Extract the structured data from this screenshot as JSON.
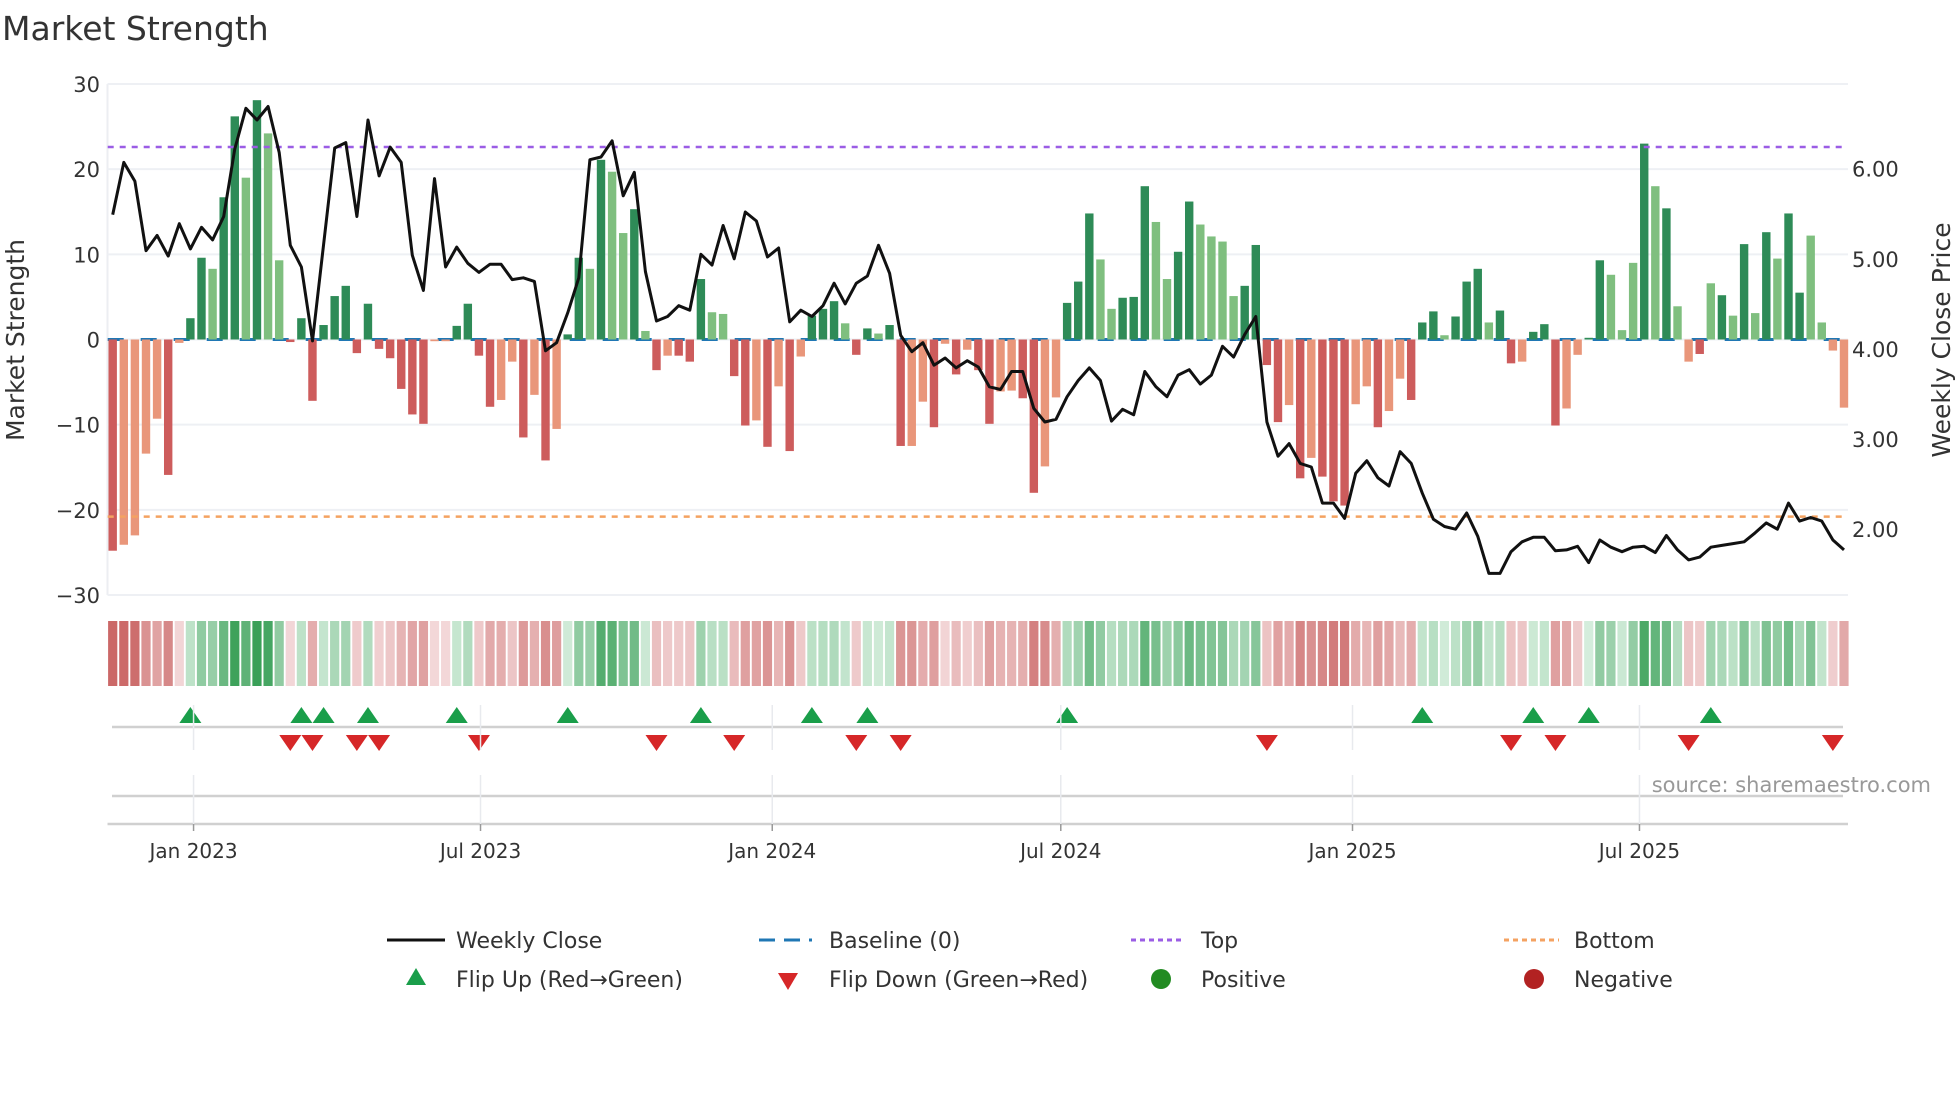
{
  "title": "Market Strength",
  "source": "source: sharemaestro.com",
  "colors": {
    "bar_pos_dark": "#2e8b57",
    "bar_pos_light": "#7fbf7f",
    "bar_neg_dark": "#cd5c5c",
    "bar_neg_light": "#e9967a",
    "baseline": "#1f77b4",
    "top": "#9b5de5",
    "bottom": "#f4a261",
    "flip_up": "#1a9e4a",
    "flip_down": "#d62728",
    "positive": "#228b22",
    "negative": "#b22222",
    "price": "#111111"
  },
  "chart_data": {
    "type": "bar+line",
    "title": "Market Strength",
    "ylabel": "Market Strength",
    "y2label": "Weekly Close Price",
    "ylim": [
      -30,
      30
    ],
    "y2lim": [
      1.27,
      6.94
    ],
    "yticks": [
      "30",
      "20",
      "10",
      "0",
      "−10",
      "−20",
      "−30"
    ],
    "ytick_values": [
      30,
      20,
      10,
      0,
      -10,
      -20,
      -30
    ],
    "y2ticks": [
      "6.00",
      "5.00",
      "4.00",
      "3.00",
      "2.00"
    ],
    "y2tick_values": [
      6,
      5,
      4,
      3,
      2
    ],
    "xticks": [
      {
        "label": "Jan 2023",
        "date": "2023-01-01"
      },
      {
        "label": "Jul 2023",
        "date": "2023-07-01"
      },
      {
        "label": "Jan 2024",
        "date": "2024-01-01"
      },
      {
        "label": "Jul 2024",
        "date": "2024-07-01"
      },
      {
        "label": "Jan 2025",
        "date": "2025-01-01"
      },
      {
        "label": "Jul 2025",
        "date": "2025-07-01"
      }
    ],
    "x_start": "2022-11-11",
    "x_step_days": 7,
    "grid": true,
    "top_level": 22.6,
    "bottom_level": -20.8,
    "strength": [
      -24.8,
      -24.1,
      -23.0,
      -13.4,
      -9.3,
      -15.9,
      -0.4,
      2.5,
      9.6,
      8.3,
      16.7,
      26.2,
      19.0,
      28.1,
      24.2,
      9.3,
      -0.3,
      2.5,
      -7.2,
      1.7,
      5.1,
      6.3,
      -1.6,
      4.2,
      -1.1,
      -2.2,
      -5.8,
      -8.8,
      -9.9,
      -0.2,
      -0.2,
      1.6,
      4.2,
      -1.9,
      -7.9,
      -7.1,
      -2.6,
      -11.5,
      -6.5,
      -14.2,
      -10.5,
      0.6,
      9.6,
      8.3,
      21.1,
      19.7,
      12.5,
      15.3,
      1.0,
      -3.6,
      -1.9,
      -1.9,
      -2.6,
      7.1,
      3.2,
      3.0,
      -4.3,
      -10.1,
      -9.5,
      -12.6,
      -5.5,
      -13.1,
      -2.0,
      2.8,
      3.6,
      4.5,
      1.9,
      -1.8,
      1.3,
      0.7,
      1.7,
      -12.5,
      -12.5,
      -7.3,
      -10.3,
      -0.5,
      -4.1,
      -1.2,
      -3.6,
      -9.9,
      -6.1,
      -6.0,
      -6.9,
      -18.0,
      -14.9,
      -6.8,
      4.3,
      6.8,
      14.8,
      9.4,
      3.6,
      4.9,
      5.0,
      18.0,
      13.8,
      7.1,
      10.3,
      16.2,
      13.5,
      12.1,
      11.5,
      5.1,
      6.3,
      11.1,
      -3.0,
      -9.7,
      -7.7,
      -16.3,
      -13.9,
      -16.1,
      -19.0,
      -19.5,
      -7.6,
      -5.5,
      -10.3,
      -8.4,
      -4.6,
      -7.1,
      2.0,
      3.3,
      0.5,
      2.7,
      6.8,
      8.3,
      2.0,
      3.4,
      -2.8,
      -2.6,
      0.9,
      1.8,
      -10.1,
      -8.1,
      -1.8,
      0.2,
      9.3,
      7.6,
      1.1,
      9.0,
      23.0,
      18.0,
      15.4,
      3.9,
      -2.6,
      -1.7,
      6.6,
      5.2,
      2.8,
      11.2,
      3.1,
      12.6,
      9.5,
      14.8,
      5.5,
      12.2,
      2.0,
      -1.3,
      -8.0
    ],
    "shade": "DLLLLDLDDLDDLDLLDDDDDDDDDDDDDLLDDDDLLDLDLDDLDLLDLDLDDDLLDDLDLDLDDDLDDLDDLLDLDLDDLLDDLLDDDLLDDDLLDDLLLLDDDDLDLDDDLLDLLDDDLDDDLDDLDDDLLDDLLLDLDLLDLDLDLDLDD",
    "weekly_close": [
      5.49,
      6.07,
      5.86,
      5.09,
      5.26,
      5.03,
      5.39,
      5.11,
      5.35,
      5.21,
      5.47,
      6.22,
      6.67,
      6.54,
      6.69,
      6.18,
      5.15,
      4.91,
      4.09,
      5.16,
      6.23,
      6.29,
      5.47,
      6.54,
      5.92,
      6.24,
      6.07,
      5.04,
      4.65,
      5.89,
      4.91,
      5.13,
      4.95,
      4.85,
      4.94,
      4.94,
      4.77,
      4.79,
      4.75,
      3.98,
      4.07,
      4.4,
      4.79,
      6.1,
      6.13,
      6.31,
      5.7,
      5.96,
      4.86,
      4.31,
      4.36,
      4.48,
      4.43,
      5.05,
      4.93,
      5.37,
      5.0,
      5.52,
      5.42,
      5.02,
      5.12,
      4.3,
      4.43,
      4.36,
      4.48,
      4.73,
      4.5,
      4.73,
      4.81,
      5.15,
      4.84,
      4.15,
      3.97,
      4.07,
      3.82,
      3.9,
      3.79,
      3.87,
      3.8,
      3.58,
      3.55,
      3.75,
      3.75,
      3.34,
      3.19,
      3.22,
      3.47,
      3.65,
      3.79,
      3.65,
      3.2,
      3.33,
      3.27,
      3.75,
      3.58,
      3.47,
      3.71,
      3.77,
      3.61,
      3.71,
      4.03,
      3.91,
      4.16,
      4.36,
      3.19,
      2.81,
      2.95,
      2.73,
      2.69,
      2.29,
      2.29,
      2.12,
      2.62,
      2.76,
      2.57,
      2.48,
      2.86,
      2.73,
      2.4,
      2.11,
      2.03,
      2.0,
      2.18,
      1.92,
      1.51,
      1.51,
      1.75,
      1.86,
      1.91,
      1.91,
      1.76,
      1.77,
      1.81,
      1.63,
      1.88,
      1.8,
      1.75,
      1.8,
      1.81,
      1.74,
      1.93,
      1.77,
      1.66,
      1.69,
      1.8,
      1.82,
      1.84,
      1.86,
      1.96,
      2.07,
      2.0,
      2.29,
      2.09,
      2.13,
      2.09,
      1.88,
      1.77
    ],
    "flip_up_indices": [
      7,
      17,
      19,
      23,
      31,
      41,
      53,
      63,
      68,
      86,
      118,
      128,
      133,
      144
    ],
    "flip_down_indices": [
      16,
      18,
      22,
      24,
      33,
      49,
      56,
      67,
      71,
      104,
      126,
      130,
      142,
      155
    ],
    "legend": {
      "placement": "bottom",
      "items": [
        {
          "key": "weekly-close",
          "label": "Weekly Close"
        },
        {
          "key": "baseline",
          "label": "Baseline (0)"
        },
        {
          "key": "top",
          "label": "Top"
        },
        {
          "key": "bottom",
          "label": "Bottom"
        },
        {
          "key": "flip-up",
          "label": "Flip Up (Red→Green)"
        },
        {
          "key": "flip-down",
          "label": "Flip Down (Green→Red)"
        },
        {
          "key": "positive",
          "label": "Positive"
        },
        {
          "key": "negative",
          "label": "Negative"
        }
      ]
    }
  }
}
